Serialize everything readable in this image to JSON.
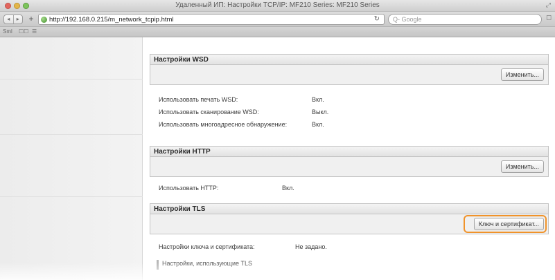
{
  "window": {
    "title": "Удаленный ИП: Настройки TCP/IP: MF210 Series: MF210 Series"
  },
  "toolbar": {
    "nav_back": "◂",
    "nav_forward": "▸",
    "add": "+",
    "url": "http://192.168.0.215/m_network_tcpip.html",
    "search_placeholder": "Q- Google"
  },
  "bookmarks": [
    "Sml",
    "☐☐",
    "☰"
  ],
  "sections": {
    "wsd": {
      "title": "Настройки WSD",
      "button": "Изменить...",
      "rows": [
        {
          "label": "Использовать печать WSD:",
          "value": "Вкл."
        },
        {
          "label": "Использовать сканирование WSD:",
          "value": "Выкл."
        },
        {
          "label": "Использовать многоадресное обнаружение:",
          "value": "Вкл."
        }
      ]
    },
    "http": {
      "title": "Настройки HTTP",
      "button": "Изменить...",
      "rows": [
        {
          "label": "Использовать HTTP:",
          "value": "Вкл."
        }
      ]
    },
    "tls": {
      "title": "Настройки TLS",
      "button": "Ключ и сертификат...",
      "rows": [
        {
          "label": "Настройки ключа и сертификата:",
          "value": "Не задано."
        }
      ],
      "subsection": "Настройки, использующие TLS"
    }
  },
  "colors": {
    "highlight": "#f0932b"
  }
}
